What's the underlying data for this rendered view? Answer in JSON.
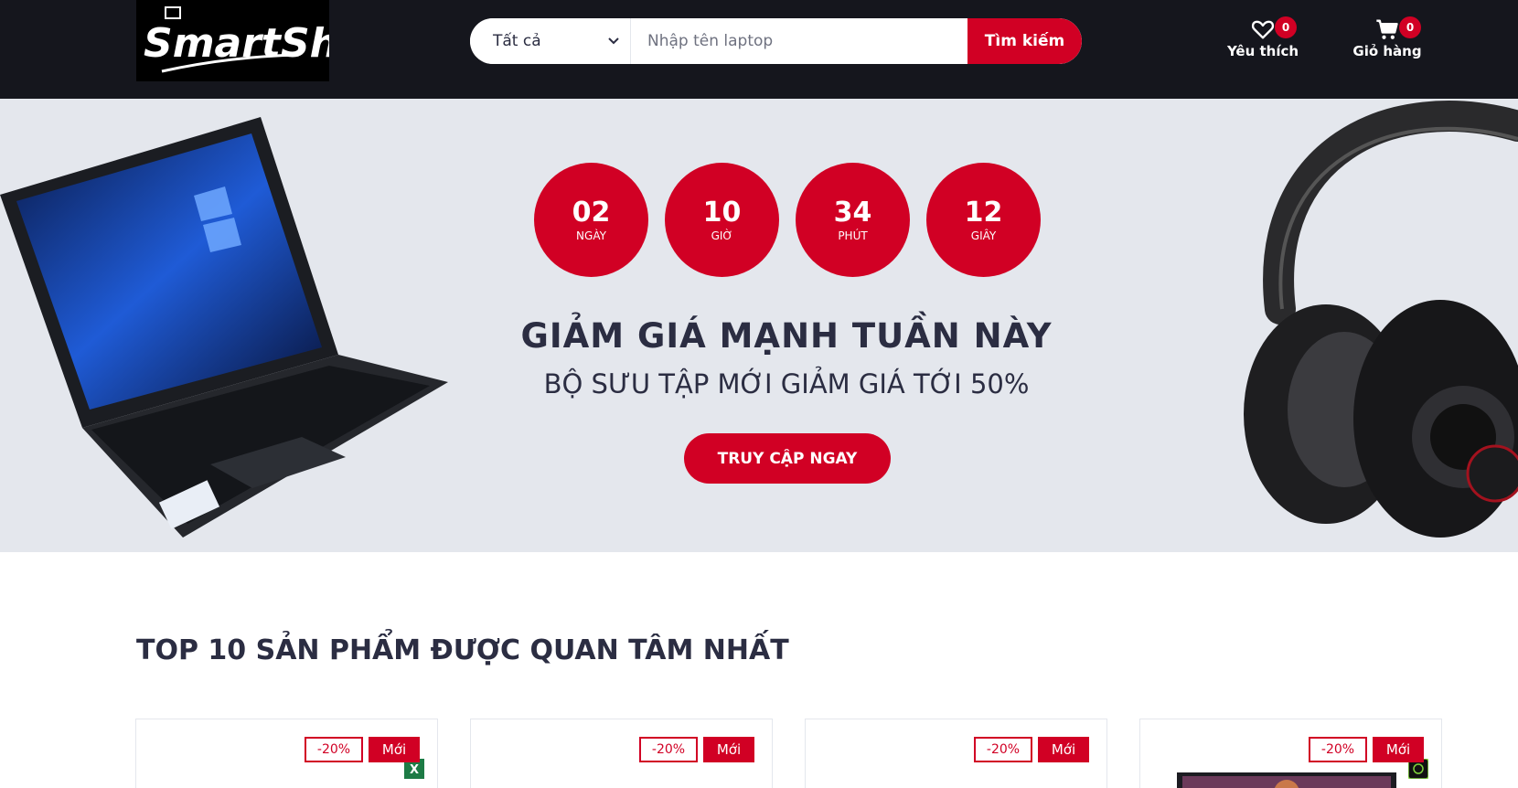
{
  "header": {
    "logo_text": "SmartShop",
    "search": {
      "category_selected": "Tất cả",
      "placeholder": "Nhập tên laptop",
      "button_label": "Tìm kiếm"
    },
    "wishlist": {
      "label": "Yêu thích",
      "count": "0",
      "icon": "heart-icon"
    },
    "cart": {
      "label": "Giỏ hàng",
      "count": "0",
      "icon": "cart-icon"
    }
  },
  "hero": {
    "countdown": [
      {
        "value": "02",
        "unit": "NGÀY"
      },
      {
        "value": "10",
        "unit": "GIỜ"
      },
      {
        "value": "34",
        "unit": "PHÚT"
      },
      {
        "value": "12",
        "unit": "GIÂY"
      }
    ],
    "title": "GIẢM GIÁ MẠNH TUẦN NÀY",
    "subtitle": "BỘ SƯU TẬP MỚI GIẢM GIÁ TỚI 50%",
    "button_label": "TRUY CẬP NGAY"
  },
  "products_section": {
    "title": "TOP 10 SẢN PHẨM ĐƯỢC QUAN TÂM NHẤT",
    "items": [
      {
        "sale": "-20%",
        "new": "Mới"
      },
      {
        "sale": "-20%",
        "new": "Mới"
      },
      {
        "sale": "-20%",
        "new": "Mới"
      },
      {
        "sale": "-20%",
        "new": "Mới"
      }
    ]
  },
  "colors": {
    "primary": "#d10024",
    "header_bg": "#15161d",
    "hero_bg": "#e4e7ed",
    "text_dark": "#2b2d42"
  }
}
